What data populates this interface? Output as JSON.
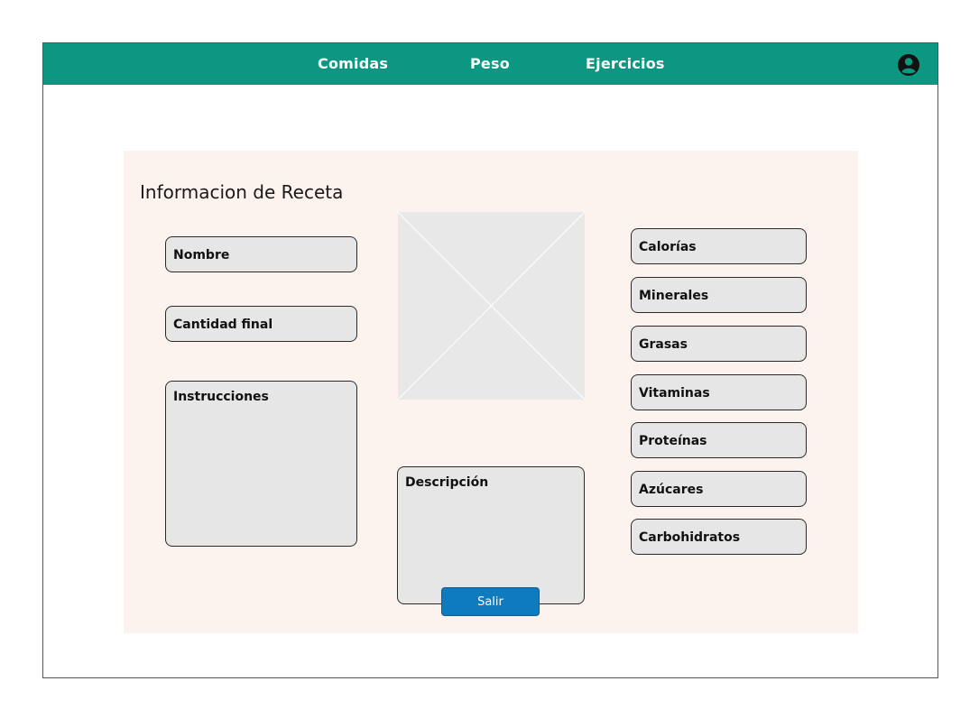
{
  "nav": {
    "items": [
      "Comidas",
      "Peso",
      "Ejercicios"
    ],
    "user_icon": "user-circle-icon",
    "color": "#0b9782"
  },
  "panel": {
    "title": "Informacion de Receta",
    "background": "#fdf3ee"
  },
  "left_fields": {
    "nombre": "Nombre",
    "cantidad_final": "Cantidad final",
    "instrucciones": "Instrucciones"
  },
  "center": {
    "image": "image-placeholder-icon",
    "descripcion": "Descripción"
  },
  "nutrients": [
    "Calorías",
    "Minerales",
    "Grasas",
    "Vitaminas",
    "Proteínas",
    "Azúcares",
    "Carbohidratos"
  ],
  "actions": {
    "exit_label": "Salir",
    "exit_color": "#0e7bbf"
  }
}
